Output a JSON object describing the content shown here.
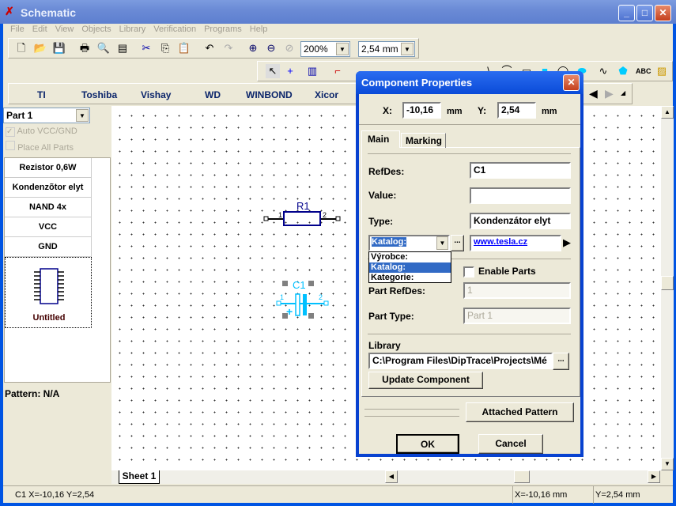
{
  "window": {
    "title": "Schematic"
  },
  "menu": [
    "File",
    "Edit",
    "View",
    "Objects",
    "Library",
    "Verification",
    "Programs",
    "Help"
  ],
  "toolbar": {
    "zoom": "200%",
    "grid": "2,54 mm"
  },
  "libraries": [
    "TI",
    "Toshiba",
    "Vishay",
    "WD",
    "WINBOND",
    "Xicor"
  ],
  "left_panel": {
    "part_select": "Part 1",
    "auto_vcc": "Auto VCC/GND",
    "place_all": "Place All Parts",
    "components": [
      "Rezistor 0,6W",
      "Kondenzõtor elyt",
      "NAND 4x",
      "VCC",
      "GND"
    ],
    "selected_component": "Untitled",
    "pattern": "Pattern: N/A"
  },
  "canvas": {
    "r1_label": "R1",
    "c1_label": "C1",
    "pin1": "1",
    "pin2": "2",
    "plus": "+"
  },
  "sheet_tab": "Sheet 1",
  "status": {
    "left": "C1  X=-10,16  Y=2,54",
    "x": "X=-10,16 mm",
    "y": "Y=2,54 mm"
  },
  "dialog": {
    "title": "Component Properties",
    "x_label": "X:",
    "x_value": "-10,16",
    "y_label": "Y:",
    "y_value": "2,54",
    "unit": "mm",
    "tabs": [
      "Main",
      "Marking"
    ],
    "refdes_label": "RefDes:",
    "refdes": "C1",
    "value_label": "Value:",
    "value": "",
    "type_label": "Type:",
    "type": "Kondenzátor elyt",
    "field_select": "Katalog:",
    "field_options": [
      "Výrobce:",
      "Katalog:",
      "Kategorie:"
    ],
    "field_value": "www.tesla.cz",
    "enable_parts": "Enable Parts",
    "part_refdes_label": "Part RefDes:",
    "part_refdes": "1",
    "part_type_label": "Part Type:",
    "part_type": "Part 1",
    "library_label": "Library",
    "library_path": "C:\\Program Files\\DipTrace\\Projects\\Mé",
    "browse": "...",
    "update_btn": "Update Component",
    "attached_btn": "Attached Pattern",
    "ok": "OK",
    "cancel": "Cancel"
  },
  "colors": {
    "title_bar": "#0054e3",
    "component_blue": "#00008b",
    "selected_cyan": "#00c0ff",
    "link": "#0000ff",
    "selection": "#316ac5"
  }
}
